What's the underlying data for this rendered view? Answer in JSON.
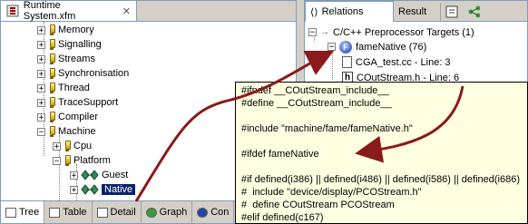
{
  "left_view": {
    "tab_title": "Runtime System.xfm",
    "close_symbol": "✕",
    "tree": [
      {
        "label": "Memory",
        "expand": "+",
        "icon": "warning-icon"
      },
      {
        "label": "Signalling",
        "expand": "+",
        "icon": "warning-icon"
      },
      {
        "label": "Streams",
        "expand": "+",
        "icon": "warning-icon"
      },
      {
        "label": "Synchronisation",
        "expand": "+",
        "icon": "warning-icon"
      },
      {
        "label": "Thread",
        "expand": "+",
        "icon": "warning-icon"
      },
      {
        "label": "TraceSupport",
        "expand": "+",
        "icon": "warning-icon"
      },
      {
        "label": "Compiler",
        "expand": "+",
        "icon": "warning-icon"
      },
      {
        "label": "Machine",
        "expand": "−",
        "icon": "warning-icon"
      },
      {
        "label": "Cpu",
        "expand": "+",
        "icon": "warning-icon"
      },
      {
        "label": "Platform",
        "expand": "−",
        "icon": "warning-icon"
      },
      {
        "label": "Guest",
        "expand": "+",
        "icon": "alternative-icon"
      },
      {
        "label": "Native",
        "expand": "+",
        "icon": "alternative-icon",
        "selected": true
      }
    ],
    "bottom_tabs": [
      {
        "label": "Tree",
        "selected": true
      },
      {
        "label": "Table"
      },
      {
        "label": "Detail"
      },
      {
        "label": "Graph"
      },
      {
        "label": "Con"
      }
    ]
  },
  "right_view": {
    "tabs": [
      {
        "label": "Relations",
        "selected": true
      },
      {
        "label": "Result"
      }
    ],
    "tree": [
      {
        "label": "C/C++ Preprocessor Targets (1)",
        "expand": "−"
      },
      {
        "label": "fameNative (76)",
        "expand": "−",
        "icon": "F"
      },
      {
        "label": "CGA_test.cc - Line: 3",
        "icon": "source-file-icon"
      },
      {
        "label": "COutStream.h - Line: 6",
        "icon": "h"
      }
    ]
  },
  "tooltip": {
    "lines": [
      "#ifndef __COutStream_include__",
      "#define __COutStream_include__",
      "",
      "#include \"machine/fame/fameNative.h\"",
      "",
      "#ifdef fameNative",
      "",
      "#if defined(i386) || defined(i486) || defined(i586) || defined(i686)",
      "#  include \"device/display/PCOStream.h\"",
      "#  define COutStream PCOStream",
      "#elif defined(c167)"
    ]
  },
  "colors": {
    "selection": "#0a246a",
    "tooltip_bg": "#ffffe1",
    "arrow": "#8b1a1a",
    "alternative_green": "#2e8b57"
  }
}
